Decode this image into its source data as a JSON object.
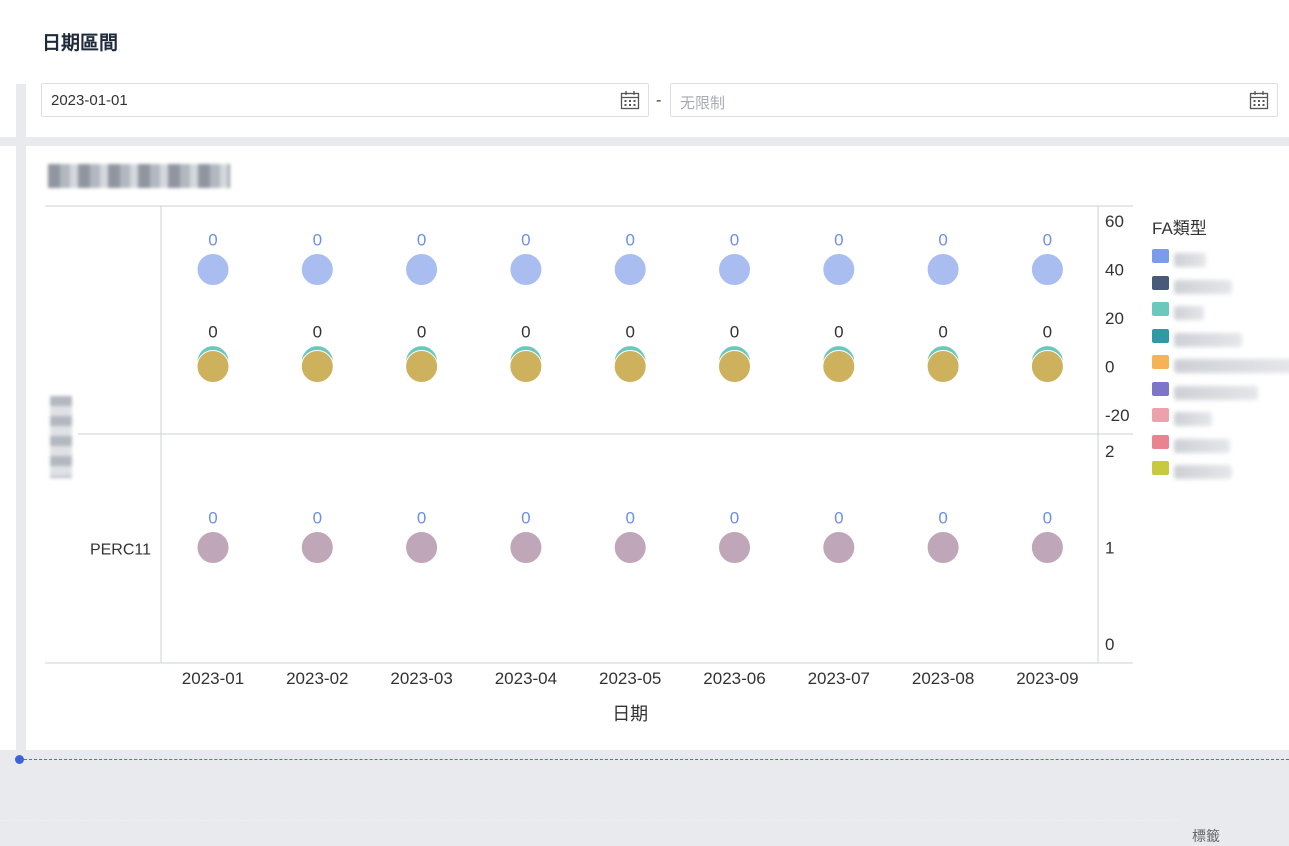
{
  "date_filter": {
    "title": "日期區間",
    "start_value": "2023-01-01",
    "end_placeholder": "无限制",
    "separator": "-"
  },
  "chart": {
    "legend_title": "FA類型",
    "legend_colors": [
      "#7b9cea",
      "#485a7a",
      "#6cc7bd",
      "#2f9aa3",
      "#f5b357",
      "#7d75c8",
      "#eca1ad",
      "#e8838f",
      "#c9c93f"
    ],
    "row_labels": [
      "PERC11"
    ],
    "x_axis_title": "日期",
    "footer_text": "標籤"
  },
  "chart_data": {
    "type": "scatter",
    "x": [
      "2023-01",
      "2023-02",
      "2023-03",
      "2023-04",
      "2023-05",
      "2023-06",
      "2023-07",
      "2023-08",
      "2023-09"
    ],
    "xlabel": "日期",
    "facets": [
      {
        "row_label": "",
        "y_ticks": [
          60,
          40,
          20,
          0,
          -20
        ],
        "ylim": [
          -20,
          60
        ],
        "series": [
          {
            "color": "#a9bdf1",
            "values": [
              40,
              40,
              40,
              40,
              40,
              40,
              40,
              40,
              40
            ],
            "labels": [
              "0",
              "0",
              "0",
              "0",
              "0",
              "0",
              "0",
              "0",
              "0"
            ],
            "label_color": "#6e8fe6"
          },
          {
            "color": "#6cc7bd",
            "values": [
              2,
              2,
              2,
              2,
              2,
              2,
              2,
              2,
              2
            ],
            "labels": [
              "0",
              "0",
              "0",
              "0",
              "0",
              "0",
              "0",
              "0",
              "0"
            ],
            "label_color": "#333333"
          },
          {
            "color": "#cdb15c",
            "values": [
              0,
              0,
              0,
              0,
              0,
              0,
              0,
              0,
              0
            ]
          }
        ]
      },
      {
        "row_label": "PERC11",
        "y_ticks": [
          2,
          1,
          0
        ],
        "ylim": [
          0,
          2
        ],
        "series": [
          {
            "color": "#bfa6b9",
            "values": [
              1,
              1,
              1,
              1,
              1,
              1,
              1,
              1,
              1
            ],
            "labels": [
              "0",
              "0",
              "0",
              "0",
              "0",
              "0",
              "0",
              "0",
              "0"
            ],
            "label_color": "#6e8fe6"
          }
        ]
      }
    ]
  }
}
